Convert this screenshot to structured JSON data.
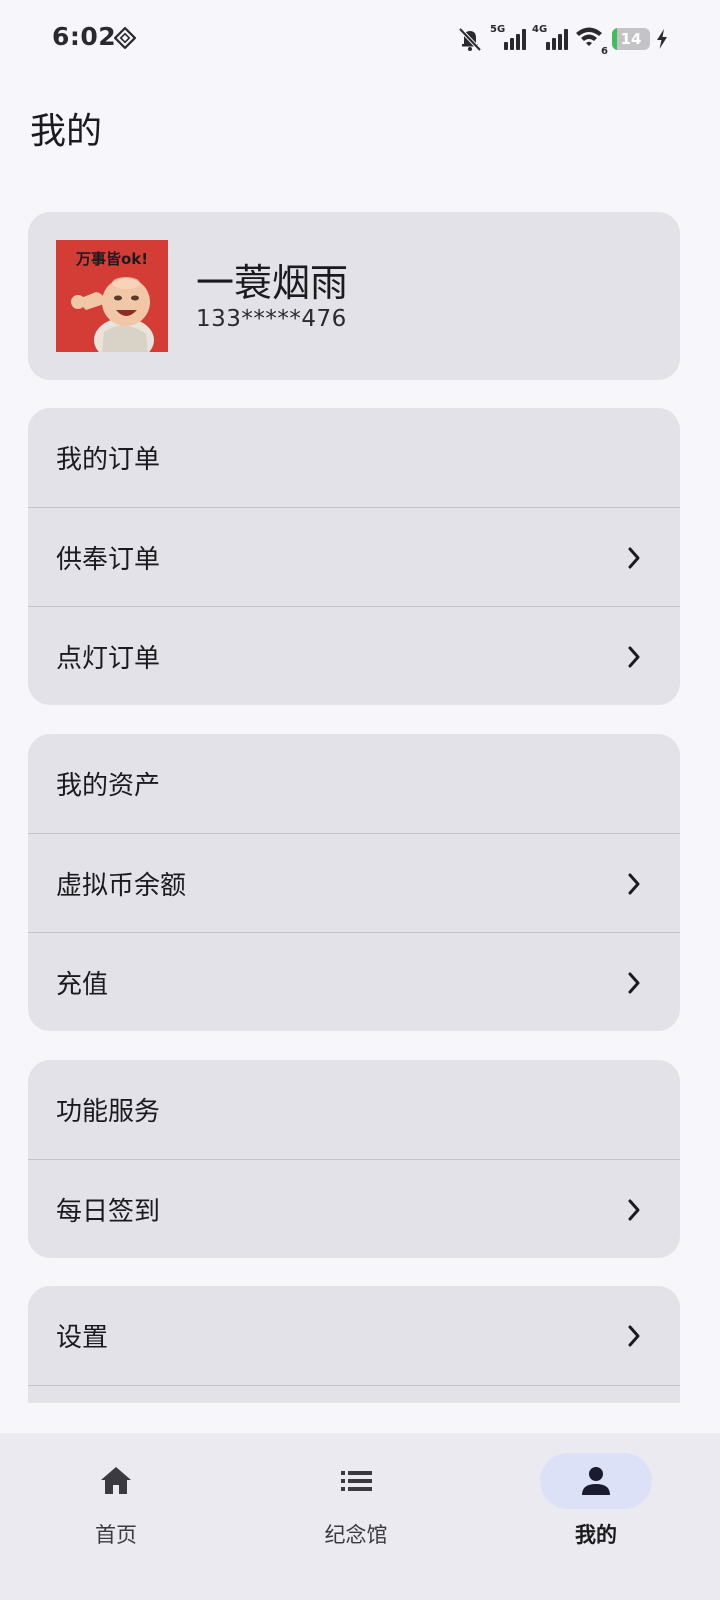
{
  "status_bar": {
    "time": "6:02",
    "signal_1_label": "5G",
    "signal_2_label": "4G",
    "wifi_label": "6",
    "battery": "14",
    "battery_level": 0.14,
    "icons": [
      "sim-icon",
      "mute-icon",
      "wifi-icon",
      "battery-icon",
      "charging-icon"
    ]
  },
  "page": {
    "title": "我的"
  },
  "profile": {
    "avatar_caption": "万事皆ok!",
    "name": "一蓑烟雨",
    "phone": "133*****476"
  },
  "sections": [
    {
      "header": "我的订单",
      "items": [
        {
          "label": "供奉订单"
        },
        {
          "label": "点灯订单"
        }
      ]
    },
    {
      "header": "我的资产",
      "items": [
        {
          "label": "虚拟币余额"
        },
        {
          "label": "充值"
        }
      ]
    },
    {
      "header": "功能服务",
      "items": [
        {
          "label": "每日签到"
        }
      ]
    },
    {
      "items": [
        {
          "label": "设置"
        }
      ]
    }
  ],
  "bottom_nav": {
    "items": [
      {
        "label": "首页",
        "icon": "home-icon"
      },
      {
        "label": "纪念馆",
        "icon": "list-icon"
      },
      {
        "label": "我的",
        "icon": "person-icon",
        "active": true
      }
    ]
  },
  "colors": {
    "background": "#f6f6fb",
    "card": "#e3e2e8",
    "active_pill": "#dde1f8",
    "avatar_bg": "#d43d35",
    "battery_green": "#3fbf5a"
  }
}
